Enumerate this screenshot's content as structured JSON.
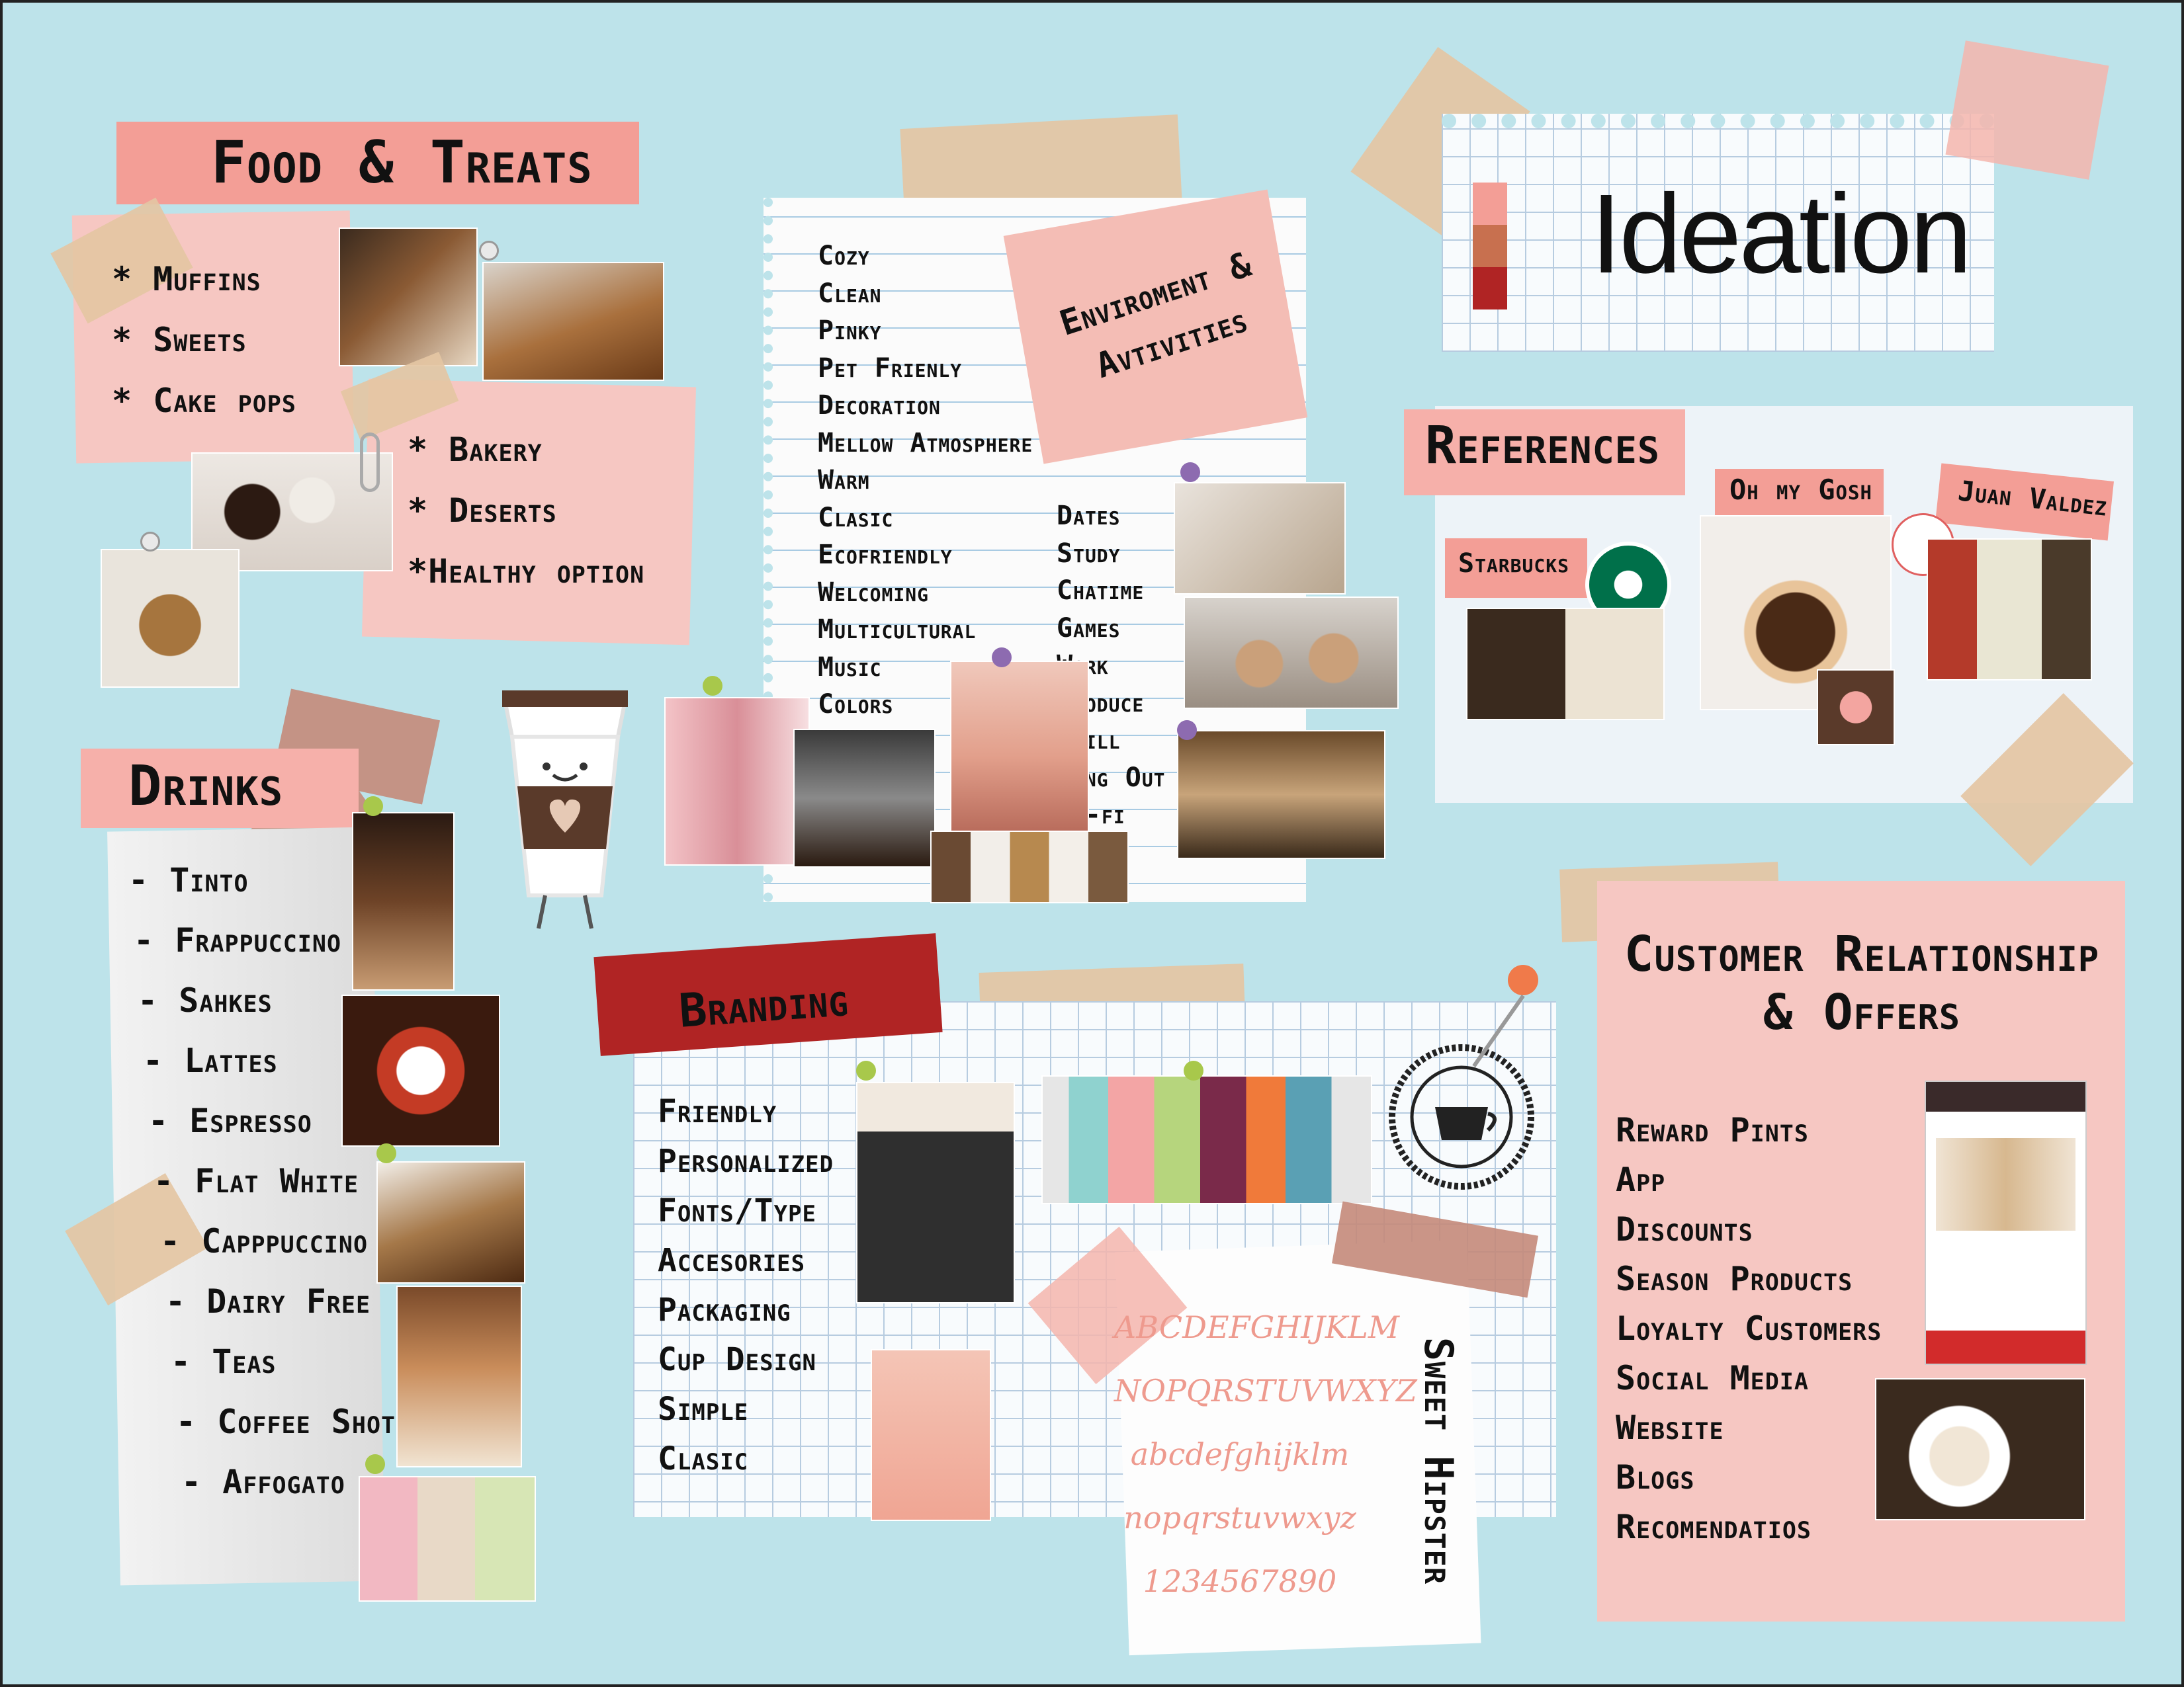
{
  "title": "Ideation",
  "colors": {
    "background": "#bde3ea",
    "pink": "#f6c7c2",
    "salmon": "#f39e96",
    "dark_red": "#b02424",
    "tape": "#e4c6a3"
  },
  "food": {
    "title": "Food & Treats",
    "list_a": [
      "* Muffins",
      "* Sweets",
      "* Cake pops"
    ],
    "list_b": [
      "* Bakery",
      "* Deserts",
      "*Healthy option"
    ]
  },
  "drinks": {
    "title": "Drinks",
    "items": [
      "- Tinto",
      "- Frappuccino",
      "- Sahkes",
      "- Lattes",
      "- Espresso",
      "- Flat White",
      "- Capppuccino",
      "- Dairy Free",
      "- Teas",
      "- Coffee Shots",
      "- Affogato"
    ]
  },
  "environment": {
    "title": "Enviroment & Avtivities",
    "col_a": [
      "Cozy",
      "Clean",
      "Pinky",
      "Pet Frienly",
      "Decoration",
      "Mellow Atmosphere",
      "Warm",
      "Clasic",
      "Ecofriendly",
      "Welcoming",
      "Multicultural",
      "Music",
      "Colors"
    ],
    "col_b": [
      "Dates",
      "Study",
      "Chatime",
      "Games",
      "Work",
      "Produce",
      "Chill",
      "Hang Out",
      "Wi-fi"
    ]
  },
  "references": {
    "title": "References",
    "labels": [
      "Starbucks",
      "Oh my Gosh",
      "Juan Valdez"
    ]
  },
  "branding": {
    "title": "Branding",
    "items": [
      "Friendly",
      "Personalized",
      "Fonts/Type",
      "Accesories",
      "Packaging",
      "Cup Design",
      "Simple",
      "Clasic"
    ],
    "font_sample": {
      "name": "Sweet Hipster",
      "lines": [
        "ABCDEFGHIJKLM",
        "NOPQRSTUVWXYZ",
        "abcdefghijklm",
        "nopqrstuvwxyz",
        "1234567890"
      ]
    }
  },
  "customer": {
    "title_line1": "Customer Relationship",
    "title_line2": "& Offers",
    "items": [
      "Reward Pints",
      "App",
      "Discounts",
      "Season Products",
      "Loyalty Customers",
      "Social Media",
      "Website",
      "Blogs",
      "Recomendatios"
    ]
  },
  "icons": [
    "push-pin-icon",
    "paper-clip-icon",
    "coffee-cup-mascot-icon",
    "coffee-stamp-icon",
    "starbucks-logo-icon",
    "juan-valdez-logo-icon"
  ]
}
